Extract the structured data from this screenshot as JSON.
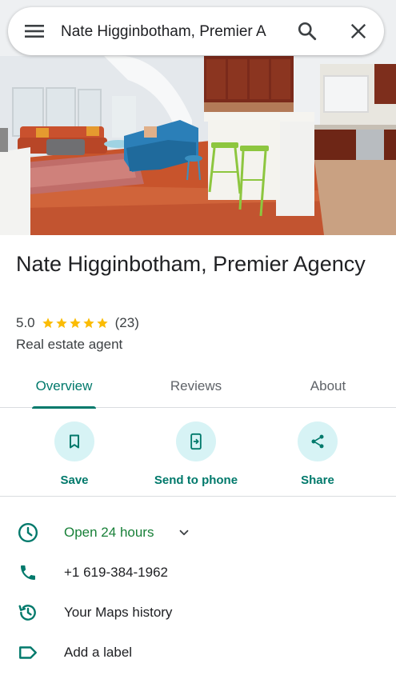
{
  "search": {
    "query": "Nate Higginbotham, Premier A"
  },
  "icons": {
    "menu": "menu-icon",
    "search": "search-icon",
    "close": "close-icon",
    "save": "bookmark-icon",
    "send": "send-to-phone-icon",
    "share": "share-icon",
    "hours": "clock-icon",
    "phone": "phone-icon",
    "history": "history-icon",
    "label": "label-icon",
    "expand": "chevron-down-icon"
  },
  "place": {
    "name": "Nate Higginbotham, Premier Agency",
    "rating": "5.0",
    "star_count": 5,
    "reviews_count": "(23)",
    "category": "Real estate agent"
  },
  "tabs": [
    {
      "label": "Overview",
      "active": true
    },
    {
      "label": "Reviews",
      "active": false
    },
    {
      "label": "About",
      "active": false
    }
  ],
  "actions": [
    {
      "label": "Save"
    },
    {
      "label": "Send to phone"
    },
    {
      "label": "Share"
    }
  ],
  "info": {
    "hours": "Open 24 hours",
    "phone": "+1 619-384-1962",
    "history": "Your Maps history",
    "label": "Add a label"
  },
  "colors": {
    "accent": "#00796b",
    "accent_bg": "#d7f3f5",
    "open_green": "#188038",
    "star": "#fbbc04",
    "text": "#202124",
    "secondary": "#5f6368"
  }
}
